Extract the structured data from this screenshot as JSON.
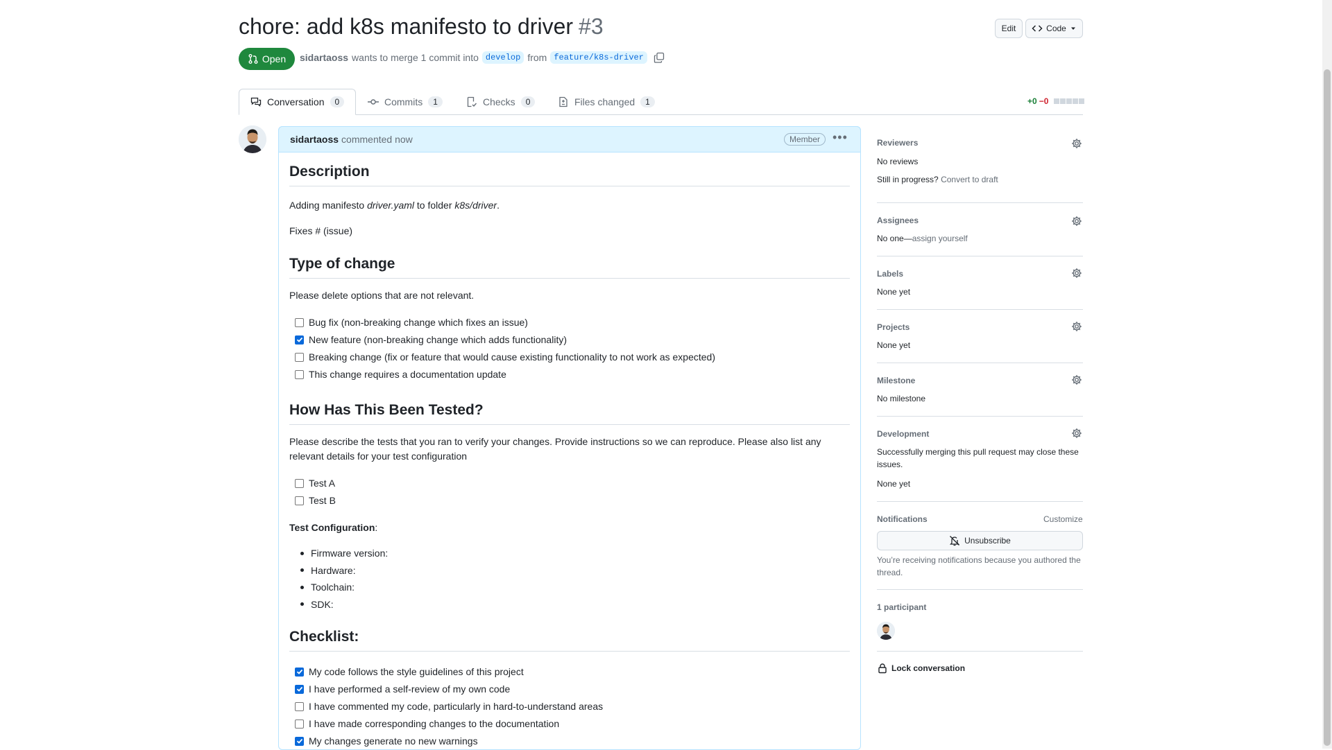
{
  "pr": {
    "title": "chore: add k8s manifesto to driver",
    "number": "#3",
    "state": "Open",
    "author": "sidartaoss",
    "merge_text": "wants to merge 1 commit into",
    "base_branch": "develop",
    "from_text": "from",
    "head_branch": "feature/k8s-driver"
  },
  "header_buttons": {
    "edit": "Edit",
    "code": "Code"
  },
  "tabs": [
    {
      "label": "Conversation",
      "count": "0",
      "icon": "comment-discussion-icon"
    },
    {
      "label": "Commits",
      "count": "1",
      "icon": "git-commit-icon"
    },
    {
      "label": "Checks",
      "count": "0",
      "icon": "checklist-icon"
    },
    {
      "label": "Files changed",
      "count": "1",
      "icon": "file-diff-icon"
    }
  ],
  "diffstat": {
    "additions": "+0",
    "deletions": "−0"
  },
  "comment": {
    "author": "sidartaoss",
    "time": "commented now",
    "badge": "Member",
    "h_description": "Description",
    "desc_prefix": "Adding manifesto ",
    "desc_file": "driver.yaml",
    "desc_mid": " to folder ",
    "desc_folder": "k8s/driver",
    "desc_end": ".",
    "fixes": "Fixes # (issue)",
    "h_type": "Type of change",
    "type_intro": "Please delete options that are not relevant.",
    "type_items": [
      {
        "label": "Bug fix (non-breaking change which fixes an issue)",
        "checked": false
      },
      {
        "label": "New feature (non-breaking change which adds functionality)",
        "checked": true
      },
      {
        "label": "Breaking change (fix or feature that would cause existing functionality to not work as expected)",
        "checked": false
      },
      {
        "label": "This change requires a documentation update",
        "checked": false
      }
    ],
    "h_tested": "How Has This Been Tested?",
    "tested_intro_1": "Please describe the tests that you ran to verify your changes. Provide instructions so we can reproduce. Please also list any",
    "tested_intro_2": "relevant details for your test configuration",
    "test_items": [
      {
        "label": "Test A",
        "checked": false
      },
      {
        "label": "Test B",
        "checked": false
      }
    ],
    "test_config_label": "Test Configuration",
    "test_config_colon": ":",
    "config_items": [
      "Firmware version:",
      "Hardware:",
      "Toolchain:",
      "SDK:"
    ],
    "h_checklist": "Checklist:",
    "checklist_items": [
      {
        "label": "My code follows the style guidelines of this project",
        "checked": true
      },
      {
        "label": "I have performed a self-review of my own code",
        "checked": true
      },
      {
        "label": "I have commented my code, particularly in hard-to-understand areas",
        "checked": false
      },
      {
        "label": "I have made corresponding changes to the documentation",
        "checked": false
      },
      {
        "label": "My changes generate no new warnings",
        "checked": true
      }
    ]
  },
  "sidebar": {
    "reviewers": {
      "title": "Reviewers",
      "value": "No reviews",
      "progress_q": "Still in progress?",
      "draft_link": "Convert to draft"
    },
    "assignees": {
      "title": "Assignees",
      "value": "No one—",
      "assign_link": "assign yourself"
    },
    "labels": {
      "title": "Labels",
      "value": "None yet"
    },
    "projects": {
      "title": "Projects",
      "value": "None yet"
    },
    "milestone": {
      "title": "Milestone",
      "value": "No milestone"
    },
    "development": {
      "title": "Development",
      "desc_1": "Successfully merging this pull request may close these",
      "desc_2": "issues.",
      "value": "None yet"
    },
    "notifications": {
      "title": "Notifications",
      "customize": "Customize",
      "button": "Unsubscribe",
      "reason_1": "You’re receiving notifications because you authored the",
      "reason_2": "thread."
    },
    "participants": {
      "title": "1 participant"
    },
    "lock": "Lock conversation"
  }
}
